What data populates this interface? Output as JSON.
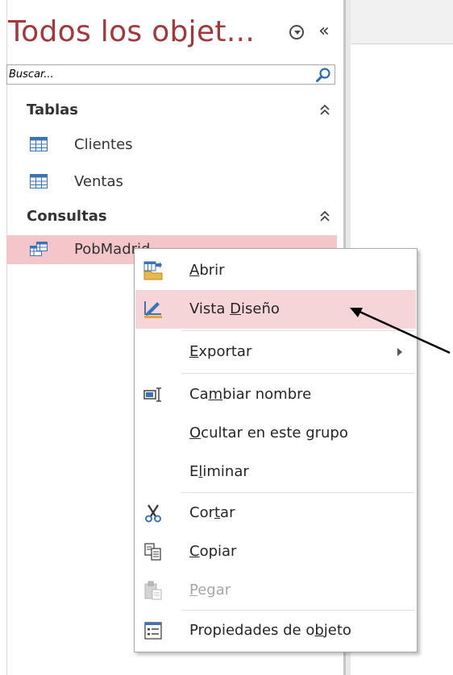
{
  "nav": {
    "title": "Todos los objet...",
    "search_placeholder": "Buscar...",
    "groups": [
      {
        "label": "Tablas",
        "items": [
          {
            "label": "Clientes"
          },
          {
            "label": "Ventas"
          }
        ]
      },
      {
        "label": "Consultas",
        "items": [
          {
            "label": "PobMadrid"
          }
        ]
      }
    ]
  },
  "context_menu": {
    "items": [
      {
        "label_pre": "",
        "label_key": "A",
        "label_post": "brir",
        "icon": "open-query-icon"
      },
      {
        "label_pre": "Vista ",
        "label_key": "D",
        "label_post": "iseño",
        "icon": "design-view-icon",
        "state": "hover"
      },
      {
        "label_pre": "",
        "label_key": "E",
        "label_post": "xportar",
        "has_submenu": true
      },
      {
        "label_pre": "Ca",
        "label_key": "m",
        "label_post": "biar nombre",
        "icon": "rename-icon"
      },
      {
        "label_pre": "",
        "label_key": "O",
        "label_post": "cultar en este grupo"
      },
      {
        "label_pre": "E",
        "label_key": "l",
        "label_post": "iminar"
      },
      {
        "label_pre": "Cor",
        "label_key": "t",
        "label_post": "ar",
        "icon": "scissors-icon"
      },
      {
        "label_pre": "",
        "label_key": "C",
        "label_post": "opiar",
        "icon": "copy-icon"
      },
      {
        "label_pre": "",
        "label_key": "P",
        "label_post": "egar",
        "icon": "paste-icon",
        "state": "disabled"
      },
      {
        "label_pre": "Propiedades de o",
        "label_key": "b",
        "label_post": "jeto",
        "icon": "properties-icon"
      }
    ]
  },
  "colors": {
    "title": "#a4373a",
    "selected_item_bg": "#f4c6ca",
    "menu_hover_bg": "#f5d5d8"
  }
}
